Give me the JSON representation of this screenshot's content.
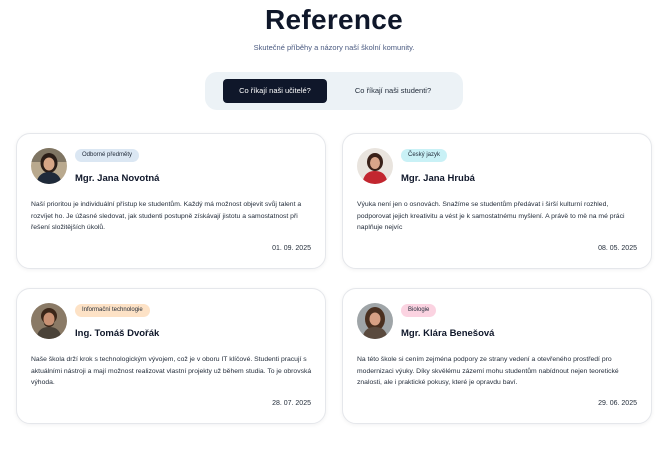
{
  "header": {
    "title": "Reference",
    "subtitle": "Skutečné příběhy a názory naší školní komunity."
  },
  "tabs": [
    {
      "label": "Co říkají naši učitelé?",
      "active": true
    },
    {
      "label": "Co říkají naši studenti?",
      "active": false
    }
  ],
  "colors": {
    "tab_active_bg": "#0f172a",
    "tab_bar_bg": "#ecf2f6"
  },
  "cards": [
    {
      "badge": "Odborné předměty",
      "badge_color": "#dbe7f3",
      "name": "Mgr. Jana Novotná",
      "text": "Naší prioritou je individuální přístup ke studentům. Každý má možnost objevit svůj talent a rozvíjet ho. Je úžasné sledovat, jak studenti postupně získávají jistotu a samostatnost při řešení složitějších úkolů.",
      "date": "01. 09. 2025"
    },
    {
      "badge": "Český jazyk",
      "badge_color": "#c9f1f6",
      "name": "Mgr. Jana Hrubá",
      "text": "Výuka není jen o osnovách. Snažíme se studentům předávat i širší kulturní rozhled, podporovat jejich kreativitu a vést je k samostatnému myšlení. A právě to mě na mé práci naplňuje nejvíc",
      "date": "08. 05. 2025"
    },
    {
      "badge": "Informační technologie",
      "badge_color": "#fde2c6",
      "name": "Ing. Tomáš Dvořák",
      "text": "Naše škola drží krok s technologickým vývojem, což je v oboru IT klíčové. Studenti pracují s aktuálními nástroji a mají možnost realizovat vlastní projekty už během studia. To je obrovská výhoda.",
      "date": "28. 07. 2025"
    },
    {
      "badge": "Biologie",
      "badge_color": "#fbd3e1",
      "name": "Mgr. Klára Benešová",
      "text": "Na této škole si cením zejména podpory ze strany vedení a otevřeného prostředí pro modernizaci výuky. Díky skvělému zázemí mohu studentům nabídnout nejen teoretické znalosti, ale i praktické pokusy, které je opravdu baví.",
      "date": "29. 06. 2025"
    }
  ]
}
